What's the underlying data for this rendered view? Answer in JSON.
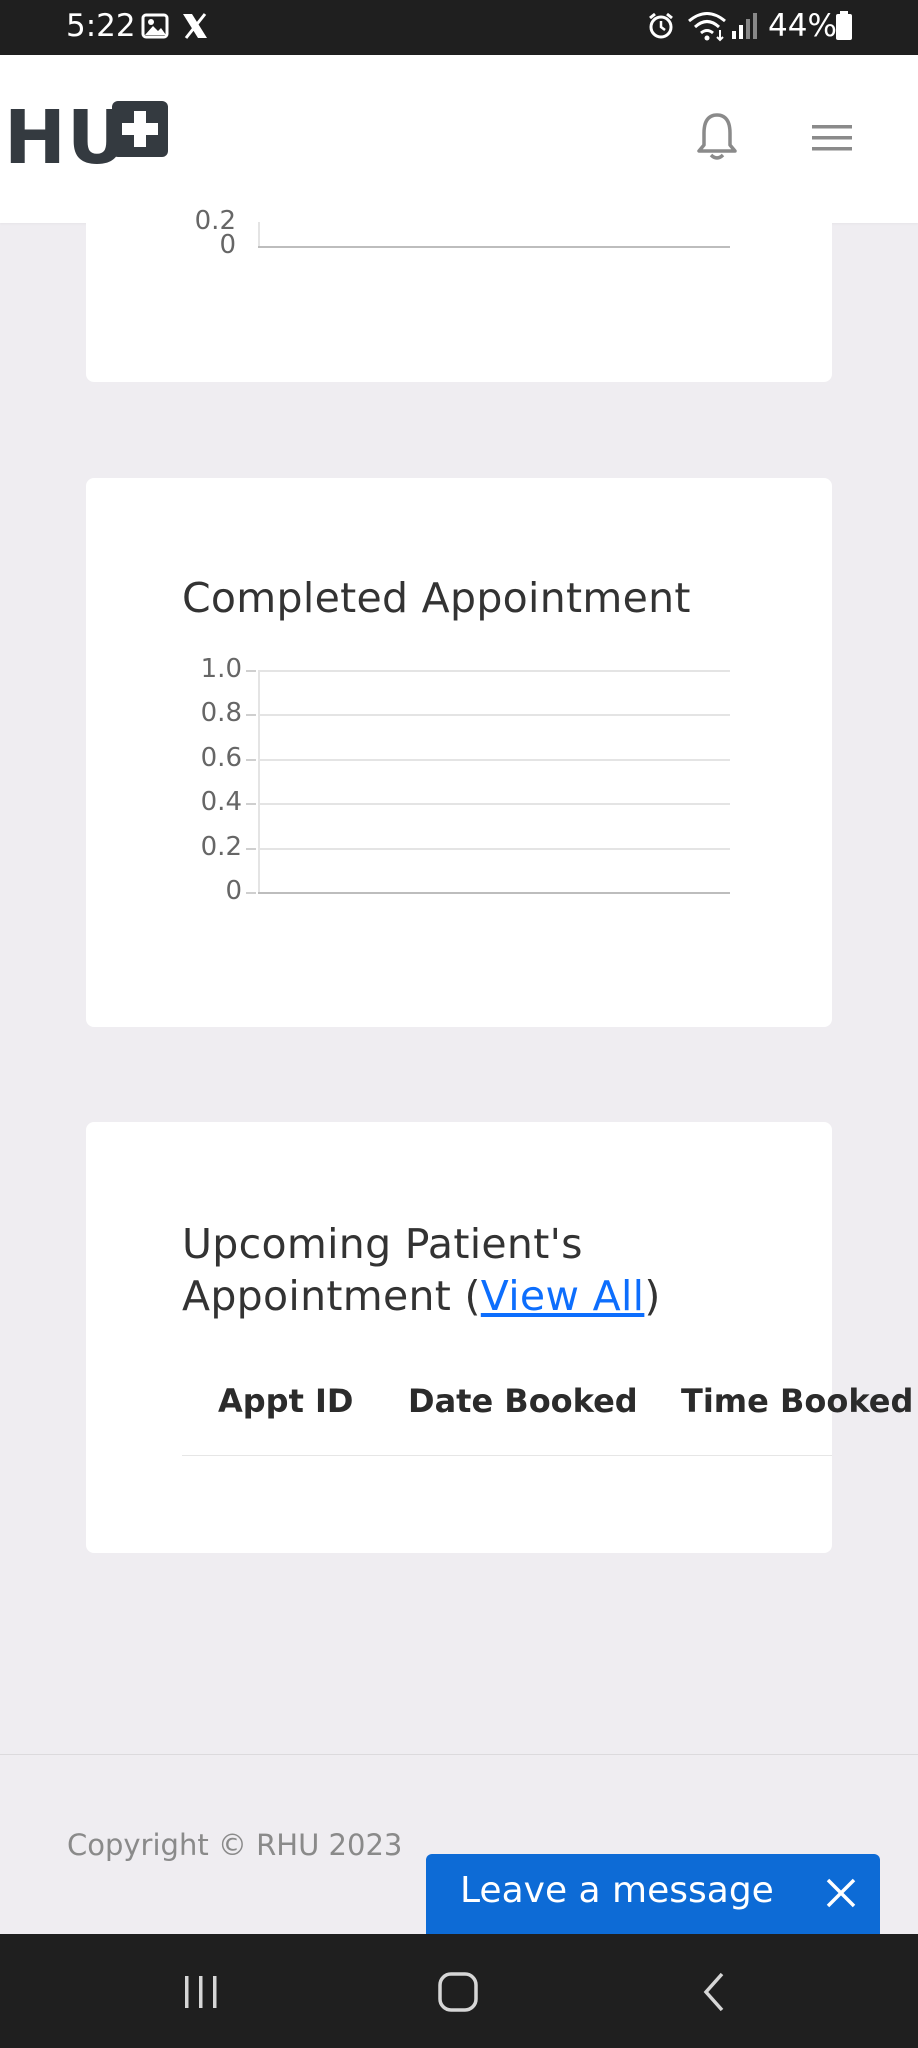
{
  "status_bar": {
    "time": "5:22",
    "battery": "44%"
  },
  "header": {
    "logo_text": "HU"
  },
  "card_top": {
    "tick_labels": [
      "0.2",
      "0"
    ]
  },
  "completed_card": {
    "title": "Completed Appointment",
    "chart_data": {
      "type": "line",
      "title": "Completed Appointment",
      "xlabel": "",
      "ylabel": "",
      "ylim": [
        0,
        1.0
      ],
      "yticks": [
        "1.0",
        "0.8",
        "0.6",
        "0.4",
        "0.2",
        "0"
      ],
      "series": []
    }
  },
  "upcoming_card": {
    "title_line1": "Upcoming Patient's",
    "title_line2_prefix": "Appointment (",
    "view_all": "View All",
    "title_line2_suffix": ")",
    "columns": [
      "Appt ID",
      "Date Booked",
      "Time Booked"
    ]
  },
  "footer": {
    "copyright": "Copyright © RHU 2023"
  },
  "chat": {
    "label": "Leave a message"
  }
}
